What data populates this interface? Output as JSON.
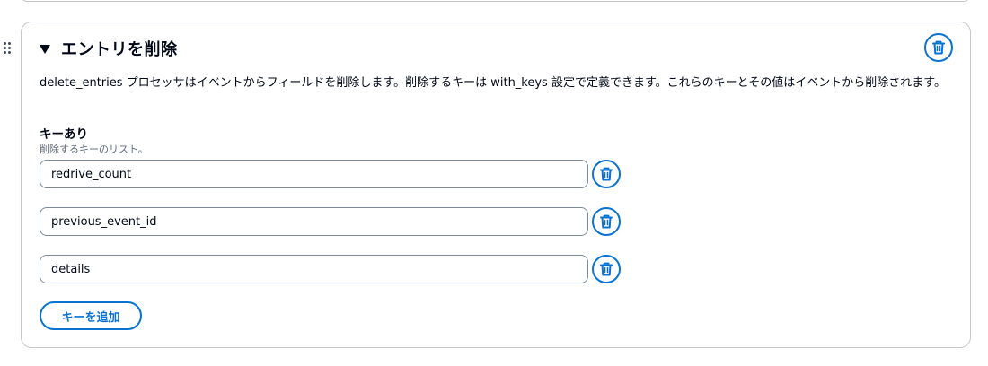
{
  "section": {
    "title": "エントリを削除",
    "description": "delete_entries プロセッサはイベントからフィールドを削除します。削除するキーは with_keys 設定で定義できます。これらのキーとその値はイベントから削除されます。"
  },
  "keys_field": {
    "label": "キーあり",
    "hint": "削除するキーのリスト。",
    "values": [
      "redrive_count",
      "previous_event_id",
      "details"
    ]
  },
  "add_button_label": "キーを追加",
  "colors": {
    "accent": "#0972d3",
    "border": "#c6c6cd",
    "input_border": "#7d8998"
  },
  "icons": {
    "remove": "trash-icon",
    "collapse": "caret-down-icon",
    "drag": "drag-handle-icon"
  }
}
